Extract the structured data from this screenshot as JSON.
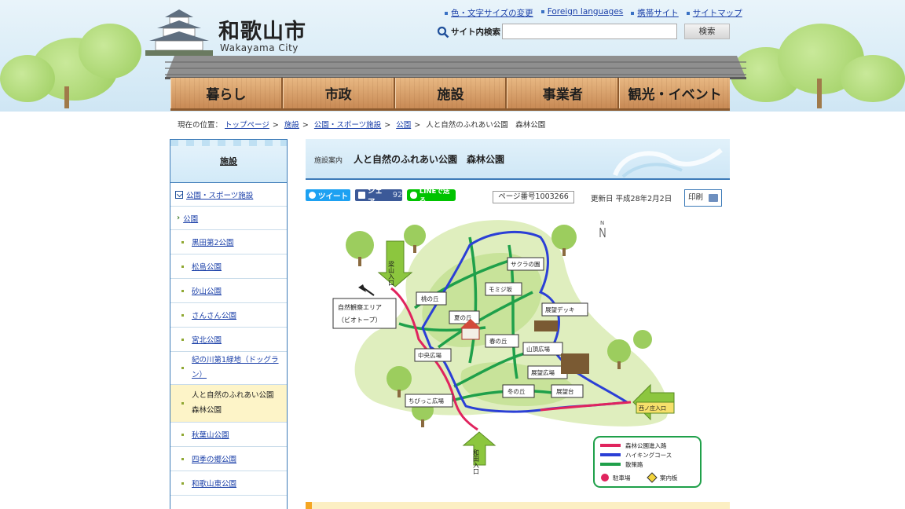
{
  "header": {
    "site_title": "和歌山市",
    "site_subtitle": "Wakayama City",
    "util_links": [
      "色・文字サイズの変更",
      "Foreign languages",
      "携帯サイト",
      "サイトマップ"
    ],
    "search": {
      "label": "サイト内検索",
      "placeholder": "",
      "button": "検索"
    }
  },
  "nav": [
    "暮らし",
    "市政",
    "施設",
    "事業者",
    "観光・イベント"
  ],
  "breadcrumb": {
    "prefix": "現在の位置：",
    "items": [
      "トップページ",
      "施設",
      "公園・スポーツ施設",
      "公園"
    ],
    "current": "人と自然のふれあい公園　森林公園"
  },
  "sidebar": {
    "heading": "施設",
    "category": "公園・スポーツ施設",
    "sub": "公園",
    "items": [
      "黒田第2公園",
      "松島公園",
      "砂山公園",
      "さんさん公園",
      "宮北公園",
      "紀の川第1緑地（ドッグラン）"
    ],
    "current": "人と自然のふれあい公園　森林公園",
    "items_after": [
      "秋葉山公園",
      "四季の郷公園",
      "和歌山東公園"
    ]
  },
  "main": {
    "category": "施設案内",
    "title": "人と自然のふれあい公園　森林公園",
    "tweet": "ツイート",
    "share": "シェア",
    "share_count": "92",
    "line": "LINEで送る",
    "page_number": "ページ番号1003266",
    "updated": "更新日 平成28年2月2日",
    "print": "印刷"
  },
  "map": {
    "north": "N",
    "entrance_top": "梁山入口",
    "entrance_bottom": "和田入口",
    "entrance_right": "西ノ庄入口",
    "nature_area_1": "自然観察エリア",
    "nature_area_2": "（ビオトープ）",
    "labels": [
      "サクラの園",
      "モミジ坂",
      "桃の丘",
      "夏の丘",
      "展望デッキ",
      "春の丘",
      "山頂広場",
      "中央広場",
      "展望広場",
      "冬の丘",
      "展望台",
      "ちびっこ広場"
    ],
    "legend": [
      "森林公園進入路",
      "ハイキングコース",
      "散策路",
      "駐車場",
      "案内板"
    ],
    "colors": {
      "entry": "#e0245e",
      "hiking": "#2b3fd6",
      "path": "#1fa04a",
      "land": "#dfeebe",
      "forest": "#9ccd5e"
    }
  }
}
